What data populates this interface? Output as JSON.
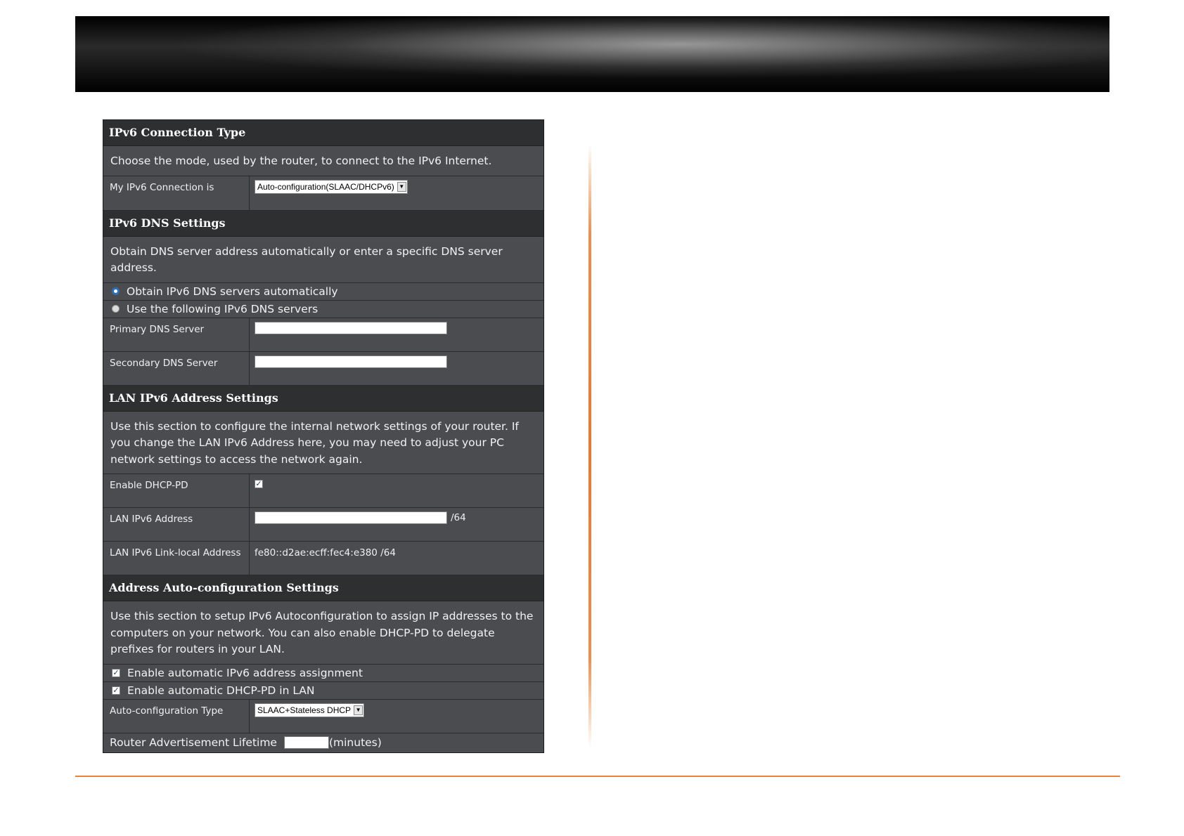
{
  "connection": {
    "title": "IPv6 Connection Type",
    "description": "Choose the mode, used by the router, to connect to the IPv6 Internet.",
    "label": "My IPv6 Connection is",
    "selected": "Auto-configuration(SLAAC/DHCPv6)"
  },
  "dns": {
    "title": "IPv6 DNS Settings",
    "description": "Obtain DNS server address automatically or enter a specific DNS server address.",
    "option_auto": "Obtain IPv6 DNS servers automatically",
    "option_manual": "Use the following IPv6 DNS servers",
    "primary_label": "Primary DNS Server",
    "primary_value": "",
    "secondary_label": "Secondary DNS Server",
    "secondary_value": ""
  },
  "lan": {
    "title": "LAN IPv6 Address Settings",
    "description": "Use this section to configure the internal network settings of your router. If you change the LAN IPv6 Address here, you may need to adjust your PC network settings to access the network again.",
    "dhcp_pd_label": "Enable DHCP-PD",
    "dhcp_pd_checked": true,
    "address_label": "LAN IPv6 Address",
    "address_value": "",
    "address_suffix": "/64",
    "link_local_label": "LAN IPv6 Link-local Address",
    "link_local_value": "fe80::d2ae:ecff:fec4:e380 /64"
  },
  "autoconf": {
    "title": "Address Auto-configuration Settings",
    "description": "Use this section to setup IPv6 Autoconfiguration to assign IP addresses to the computers on your network. You can also enable DHCP-PD to delegate prefixes for routers in your LAN.",
    "enable_auto_label": "Enable automatic IPv6 address assignment",
    "enable_pd_label": "Enable automatic DHCP-PD in LAN",
    "type_label": "Auto-configuration Type",
    "type_selected": "SLAAC+Stateless DHCP",
    "lifetime_label": "Router Advertisement Lifetime",
    "lifetime_value": "",
    "lifetime_unit": "(minutes)"
  },
  "colors": {
    "accent_line": "#e8823c",
    "panel_bg": "#4b4c4f",
    "header_bg": "#2e2f31",
    "radio_selected": "#2f6fb5"
  }
}
